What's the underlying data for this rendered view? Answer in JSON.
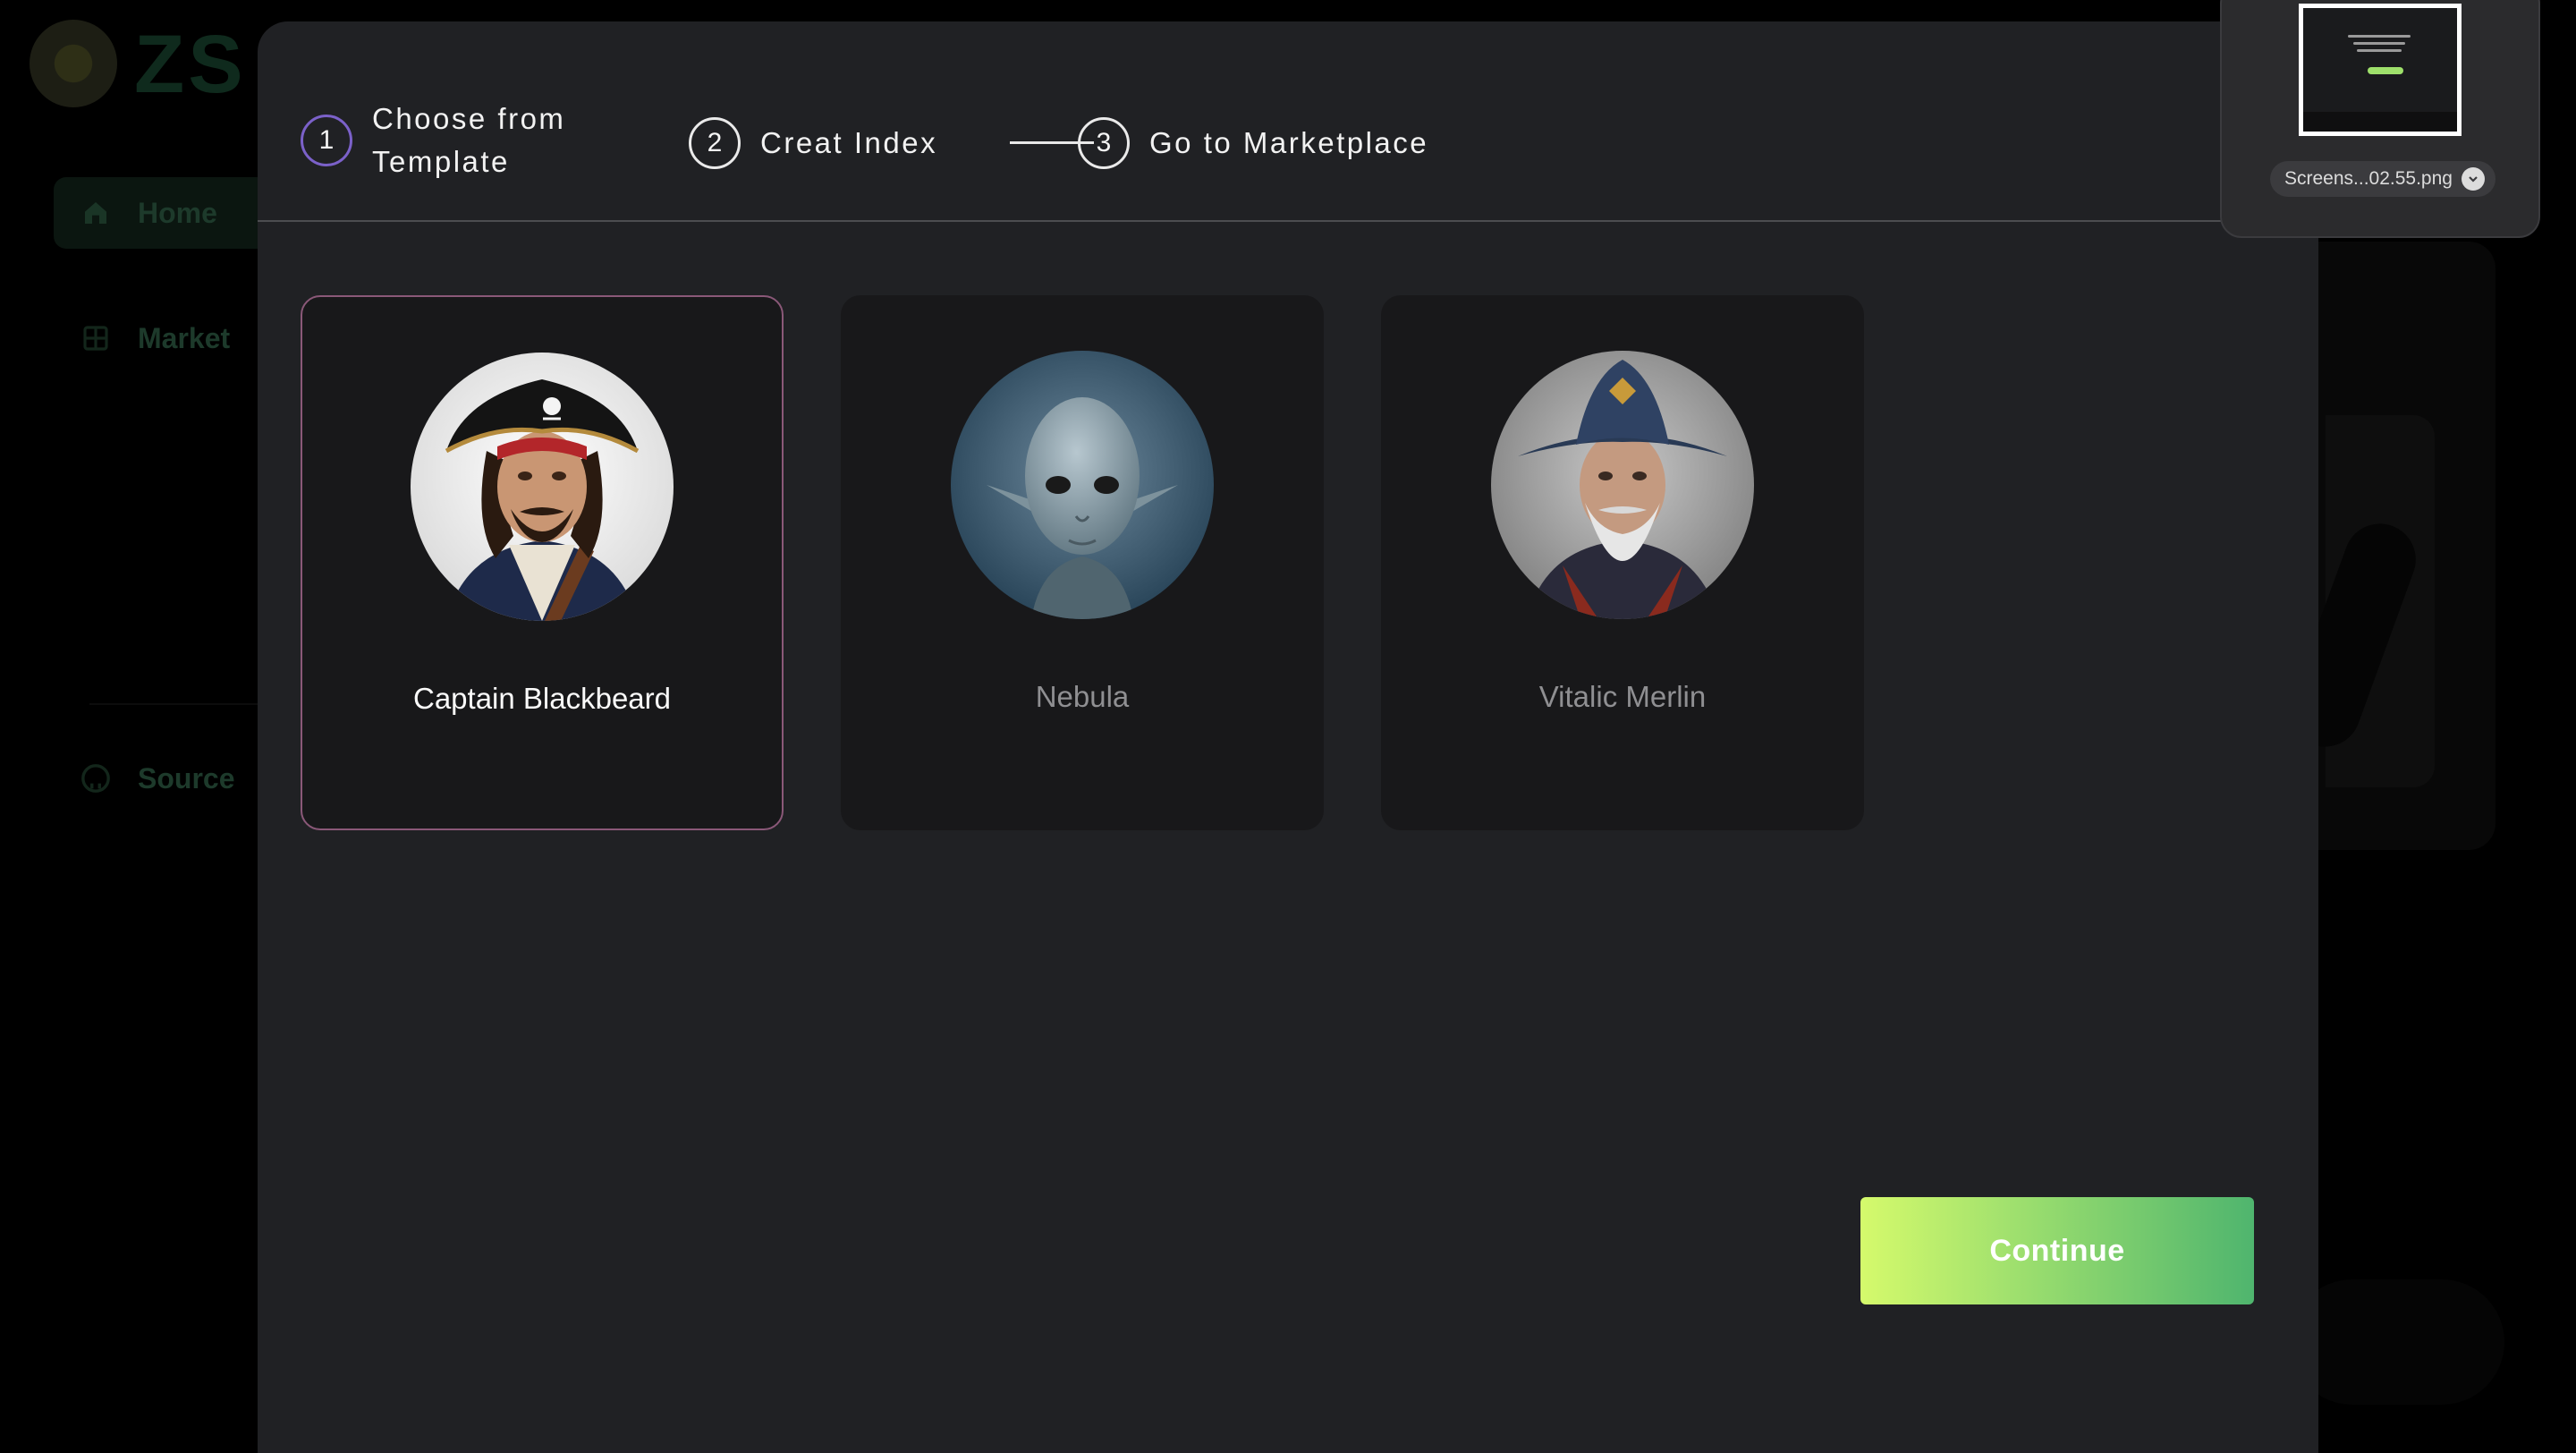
{
  "background_app": {
    "logo_text": "ZS",
    "nav": [
      {
        "label": "Home",
        "icon": "home-icon",
        "active": true
      },
      {
        "label": "Market",
        "icon": "grid-icon",
        "active": false
      },
      {
        "label": "Source",
        "icon": "github-icon",
        "active": false
      }
    ]
  },
  "stepper": {
    "steps": [
      {
        "number": "1",
        "label": "Choose from\nTemplate",
        "active": true
      },
      {
        "number": "2",
        "label": "Creat Index",
        "active": false
      },
      {
        "number": "3",
        "label": "Go to Marketplace",
        "active": false
      }
    ]
  },
  "templates": [
    {
      "name": "Captain Blackbeard",
      "avatar": "pirate-avatar",
      "selected": true
    },
    {
      "name": "Nebula",
      "avatar": "alien-avatar",
      "selected": false
    },
    {
      "name": "Vitalic Merlin",
      "avatar": "wizard-avatar",
      "selected": false
    }
  ],
  "actions": {
    "continue_label": "Continue"
  },
  "screenshot_thumbnail": {
    "filename": "Screens...02.55.png"
  },
  "colors": {
    "modal_bg": "#202124",
    "card_bg": "#18181a",
    "selected_border": "#8a5878",
    "active_step_ring": "#7b61c9",
    "continue_gradient_start": "#d5fa6c",
    "continue_gradient_end": "#4fb56e"
  }
}
